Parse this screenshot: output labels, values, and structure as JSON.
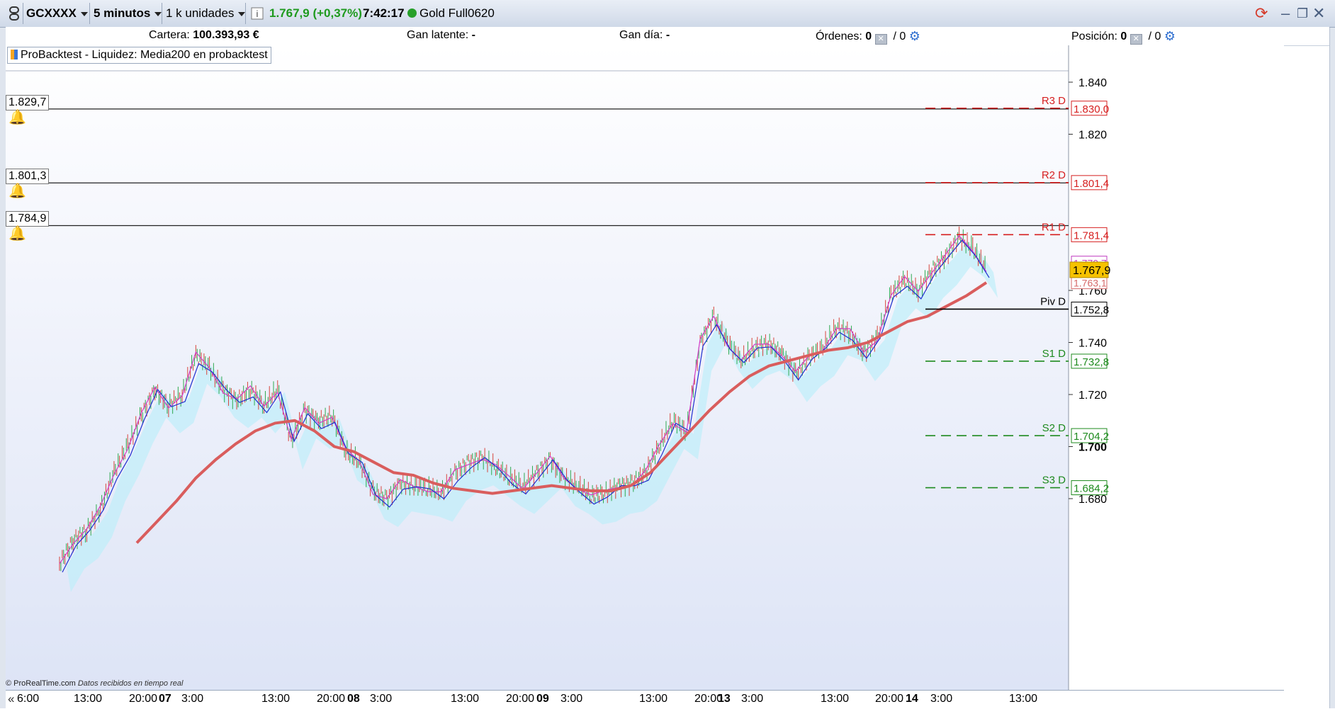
{
  "toolbar": {
    "symbol": "GCXXXX",
    "timeframe": "5 minutos",
    "units": "1 k unidades",
    "price_change": "1.767,9 (+0,37%)",
    "time": "7:42:17",
    "instrument": "Gold Full0620"
  },
  "status": {
    "cartera_label": "Cartera:",
    "cartera_value": "100.393,93 €",
    "gan_latente_label": "Gan latente:",
    "gan_latente_value": "-",
    "gan_dia_label": "Gan día:",
    "gan_dia_value": "-",
    "ordenes_label": "Órdenes:",
    "ordenes_a": "0",
    "ordenes_b": "/ 0",
    "posicion_label": "Posición:",
    "posicion_a": "0",
    "posicion_b": "/ 0"
  },
  "legend": "ProBacktest - Liquidez: Media200 en probacktest",
  "alerts": [
    "1.829,7",
    "1.801,3",
    "1.784,9"
  ],
  "credit": {
    "site": "© ProRealTime.com",
    "note": "Datos recibidos en tiempo real"
  },
  "x_ticks": [
    {
      "label": "6:00",
      "bold": false
    },
    {
      "label": "13:00",
      "bold": false
    },
    {
      "label": "20:00",
      "bold": false
    },
    {
      "label": "07",
      "bold": true
    },
    {
      "label": "3:00",
      "bold": false
    },
    {
      "label": "13:00",
      "bold": false
    },
    {
      "label": "20:00",
      "bold": false
    },
    {
      "label": "08",
      "bold": true
    },
    {
      "label": "3:00",
      "bold": false
    },
    {
      "label": "13:00",
      "bold": false
    },
    {
      "label": "20:00",
      "bold": false
    },
    {
      "label": "09",
      "bold": true
    },
    {
      "label": "3:00",
      "bold": false
    },
    {
      "label": "13:00",
      "bold": false
    },
    {
      "label": "20:00",
      "bold": false
    },
    {
      "label": "13",
      "bold": true
    },
    {
      "label": "3:00",
      "bold": false
    },
    {
      "label": "13:00",
      "bold": false
    },
    {
      "label": "20:00",
      "bold": false
    },
    {
      "label": "14",
      "bold": true
    },
    {
      "label": "3:00",
      "bold": false
    },
    {
      "label": "13:00",
      "bold": false
    }
  ],
  "chart_data": {
    "type": "line",
    "y_ticks": [
      {
        "value": 1840,
        "label": "1.840"
      },
      {
        "value": 1820,
        "label": "1.820"
      },
      {
        "value": 1760,
        "label": "1.760"
      },
      {
        "value": 1740,
        "label": "1.740"
      },
      {
        "value": 1720,
        "label": "1.720"
      },
      {
        "value": 1700,
        "label": "1.700",
        "bold": true
      },
      {
        "value": 1680,
        "label": "1.680"
      }
    ],
    "ylim": [
      1650,
      1860
    ],
    "pivots": [
      {
        "name": "R3 D",
        "value": 1830.0,
        "label": "1.830,0",
        "color": "#d61f1f"
      },
      {
        "name": "R2 D",
        "value": 1801.4,
        "label": "1.801,4",
        "color": "#d61f1f"
      },
      {
        "name": "R1 D",
        "value": 1781.4,
        "label": "1.781,4",
        "color": "#d61f1f"
      },
      {
        "name": "Piv D",
        "value": 1752.8,
        "label": "1.752,8",
        "color": "#000000"
      },
      {
        "name": "S1 D",
        "value": 1732.8,
        "label": "1.732,8",
        "color": "#1e8a1e"
      },
      {
        "name": "S2 D",
        "value": 1704.2,
        "label": "1.704,2",
        "color": "#1e8a1e"
      },
      {
        "name": "S3 D",
        "value": 1684.2,
        "label": "1.684,2",
        "color": "#1e8a1e"
      }
    ],
    "alert_lines": [
      1829.7,
      1801.3,
      1784.9
    ],
    "extra_price_labels": [
      {
        "label": "1.770,7",
        "value": 1770.7,
        "color": "#c03cc0"
      },
      {
        "label": "1.763,1",
        "value": 1763.1,
        "color": "#d66a6a"
      }
    ],
    "current_price": {
      "label": "1.767,9",
      "value": 1767.9,
      "color": "#f6c200"
    },
    "price_series": [
      1655,
      1664,
      1668,
      1676,
      1690,
      1700,
      1712,
      1722,
      1716,
      1720,
      1735,
      1730,
      1722,
      1718,
      1722,
      1716,
      1722,
      1702,
      1714,
      1710,
      1712,
      1698,
      1694,
      1683,
      1680,
      1686,
      1685,
      1684,
      1682,
      1690,
      1694,
      1696,
      1692,
      1688,
      1685,
      1690,
      1695,
      1688,
      1685,
      1681,
      1682,
      1685,
      1686,
      1690,
      1700,
      1710,
      1706,
      1740,
      1750,
      1740,
      1733,
      1738,
      1740,
      1736,
      1728,
      1734,
      1738,
      1746,
      1744,
      1736,
      1742,
      1758,
      1764,
      1760,
      1768,
      1773,
      1780,
      1776,
      1768
    ],
    "ma200_series": [
      1663,
      1671,
      1679,
      1688,
      1695,
      1701,
      1706,
      1709,
      1710,
      1706,
      1700,
      1698,
      1694,
      1690,
      1689,
      1686,
      1684,
      1683,
      1682,
      1683,
      1684,
      1685,
      1684,
      1683,
      1683,
      1685,
      1690,
      1698,
      1706,
      1714,
      1721,
      1727,
      1731,
      1733,
      1735,
      1737,
      1738,
      1740,
      1744,
      1748,
      1750,
      1754,
      1758,
      1763
    ]
  }
}
